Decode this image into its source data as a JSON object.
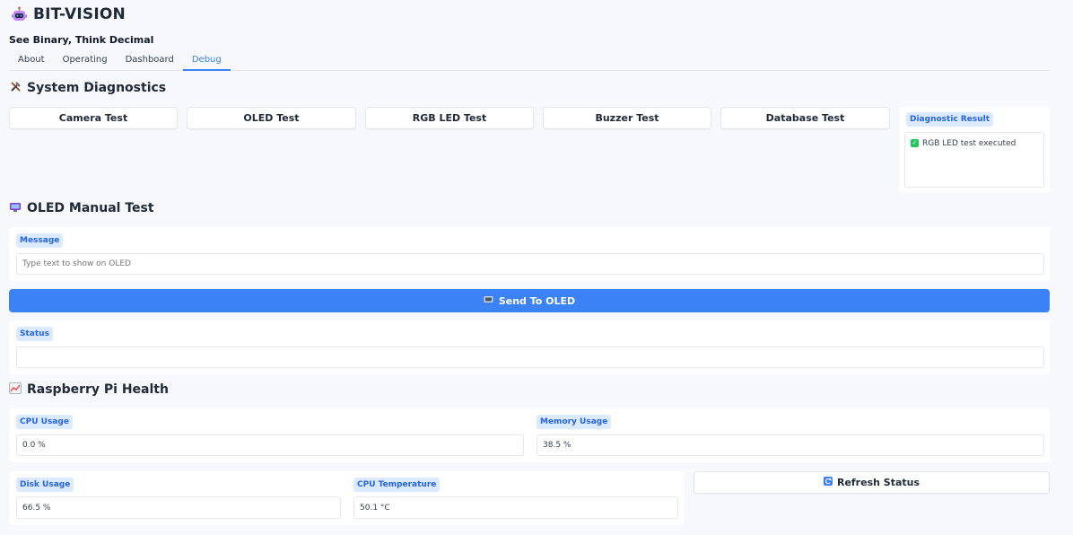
{
  "app": {
    "title": "BIT-VISION",
    "subtitle": "See Binary, Think Decimal",
    "logo_icon": "robot-icon"
  },
  "tabs": [
    {
      "label": "About",
      "active": false
    },
    {
      "label": "Operating",
      "active": false
    },
    {
      "label": "Dashboard",
      "active": false
    },
    {
      "label": "Debug",
      "active": true
    }
  ],
  "diagnostics": {
    "title": "System Diagnostics",
    "icon": "tools-icon",
    "buttons": [
      "Camera Test",
      "OLED Test",
      "RGB LED Test",
      "Buzzer Test",
      "Database Test"
    ],
    "result_label": "Diagnostic Result",
    "result_text": "RGB LED test executed",
    "result_icon": "check-icon"
  },
  "oled": {
    "title": "OLED Manual Test",
    "icon": "tv-icon",
    "message_label": "Message",
    "message_placeholder": "Type text to show on OLED",
    "message_value": "",
    "send_label": "Send To OLED",
    "send_icon": "screen-icon",
    "status_label": "Status",
    "status_value": ""
  },
  "health": {
    "title": "Raspberry Pi Health",
    "icon": "chart-up-icon",
    "cpu_label": "CPU Usage",
    "cpu_value": "0.0 %",
    "memory_label": "Memory Usage",
    "memory_value": "38.5 %",
    "disk_label": "Disk Usage",
    "disk_value": "66.5 %",
    "temp_label": "CPU Temperature",
    "temp_value": "50.1 °C",
    "refresh_label": "Refresh Status",
    "refresh_icon": "refresh-icon"
  },
  "colors": {
    "accent": "#3b82f6",
    "chip_bg": "#dbeafe",
    "chip_text": "#2563eb",
    "background": "#f6f8fb"
  }
}
